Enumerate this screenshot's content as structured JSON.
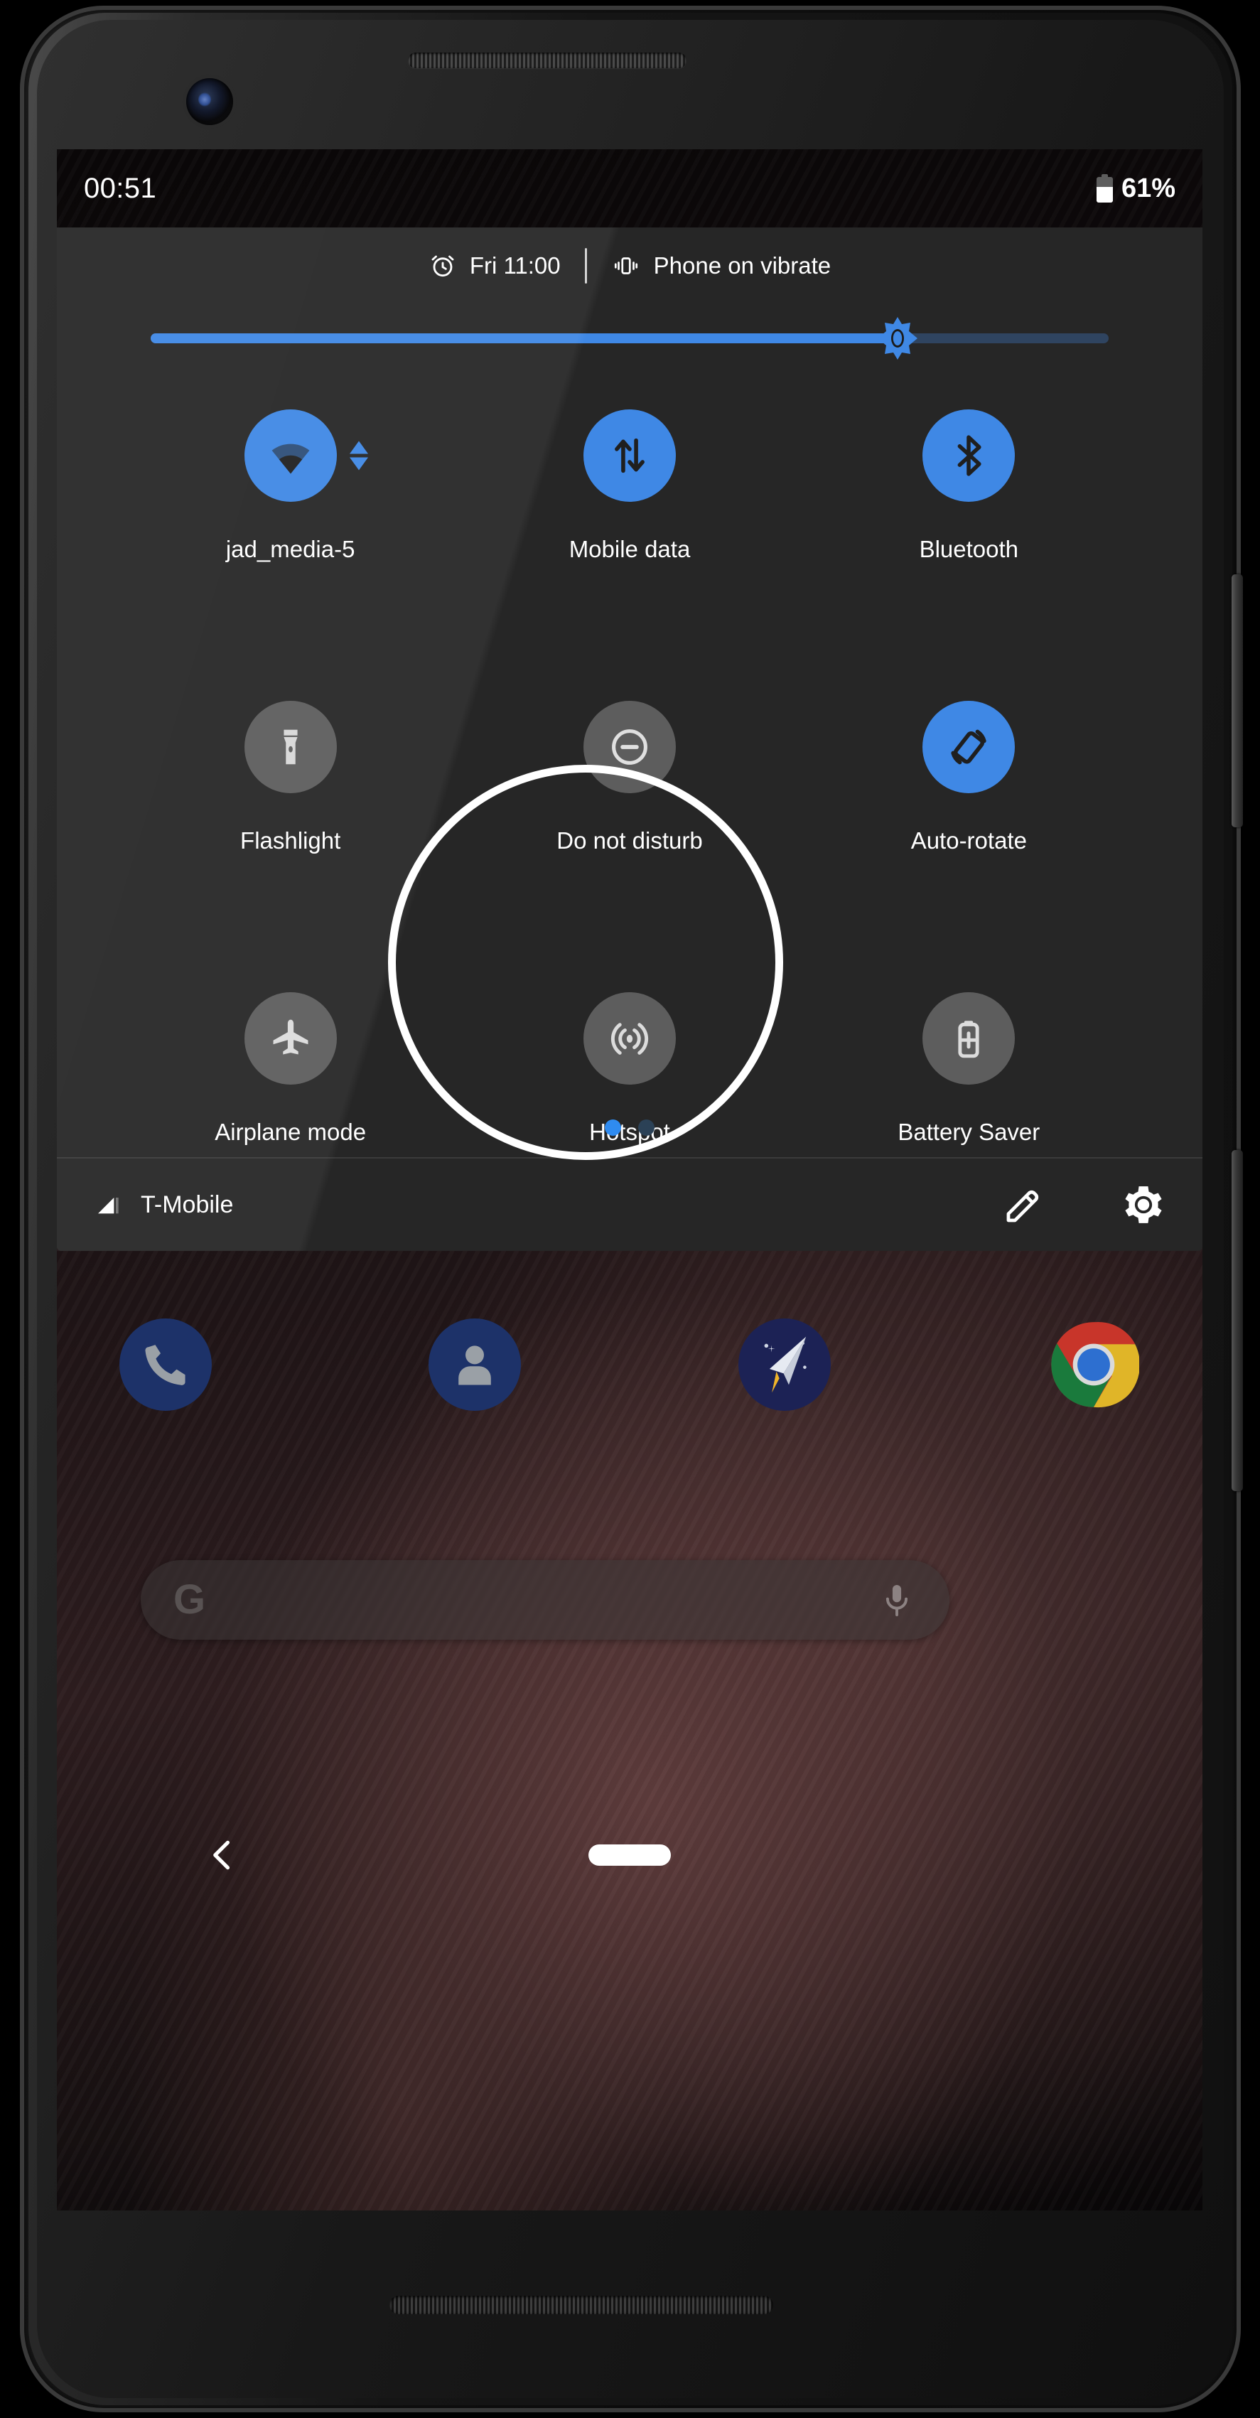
{
  "status_bar": {
    "time": "00:51",
    "battery_percent": "61%",
    "battery_level": 61,
    "battery_icon": "battery-icon"
  },
  "quick_settings": {
    "header": {
      "alarm_icon": "alarm-clock-icon",
      "alarm_text": "Fri 11:00",
      "ringer_icon": "vibrate-icon",
      "ringer_text": "Phone on vibrate"
    },
    "brightness": {
      "label": "Brightness",
      "value_percent": 78,
      "thumb_icon": "brightness-sun-icon",
      "track_color": "#2f4460",
      "fill_color": "#3f88e5"
    },
    "tiles": [
      {
        "label": "jad_media-5",
        "icon": "wifi-icon",
        "state": "on",
        "badge": "data-transfer-arrows-icon"
      },
      {
        "label": "Mobile data",
        "icon": "mobile-data-icon",
        "state": "on",
        "badge": ""
      },
      {
        "label": "Bluetooth",
        "icon": "bluetooth-icon",
        "state": "on",
        "badge": ""
      },
      {
        "label": "Flashlight",
        "icon": "flashlight-icon",
        "state": "off",
        "badge": ""
      },
      {
        "label": "Do not disturb",
        "icon": "do-not-disturb-icon",
        "state": "off",
        "badge": ""
      },
      {
        "label": "Auto-rotate",
        "icon": "auto-rotate-icon",
        "state": "on",
        "badge": ""
      },
      {
        "label": "Airplane mode",
        "icon": "airplane-icon",
        "state": "off",
        "badge": ""
      },
      {
        "label": "Hotspot",
        "icon": "hotspot-icon",
        "state": "off",
        "badge": ""
      },
      {
        "label": "Battery Saver",
        "icon": "battery-saver-icon",
        "state": "off",
        "badge": ""
      }
    ],
    "pages": {
      "count": 2,
      "active_index": 0
    },
    "footer": {
      "signal_icon": "signal-bars-icon",
      "carrier": "T-Mobile",
      "edit_icon": "pencil-edit-icon",
      "settings_icon": "gear-settings-icon"
    },
    "accent_color": "#3f88e5",
    "panel_color": "#262626"
  },
  "home_screen": {
    "dock": [
      {
        "name": "Phone",
        "icon": "phone-icon"
      },
      {
        "name": "Contacts",
        "icon": "contacts-icon"
      },
      {
        "name": "Messages",
        "icon": "messages-paper-plane-icon"
      },
      {
        "name": "Chrome",
        "icon": "chrome-icon"
      }
    ],
    "search": {
      "logo": "google-g-icon",
      "mic_icon": "microphone-icon",
      "placeholder": ""
    },
    "nav": {
      "back_icon": "back-chevron-icon",
      "home_icon": "home-pill-icon"
    }
  },
  "annotation": {
    "highlight_shape": "circle",
    "highlight_color": "#ffffff",
    "highlight_target": "quick-settings-footer-actions"
  },
  "device": {
    "earpiece_icon": "earpiece-speaker-icon",
    "camera_icon": "front-camera-icon",
    "power_button": "power-button",
    "volume_button": "volume-rocker-button",
    "bottom_speaker": "bottom-speaker-grille"
  }
}
